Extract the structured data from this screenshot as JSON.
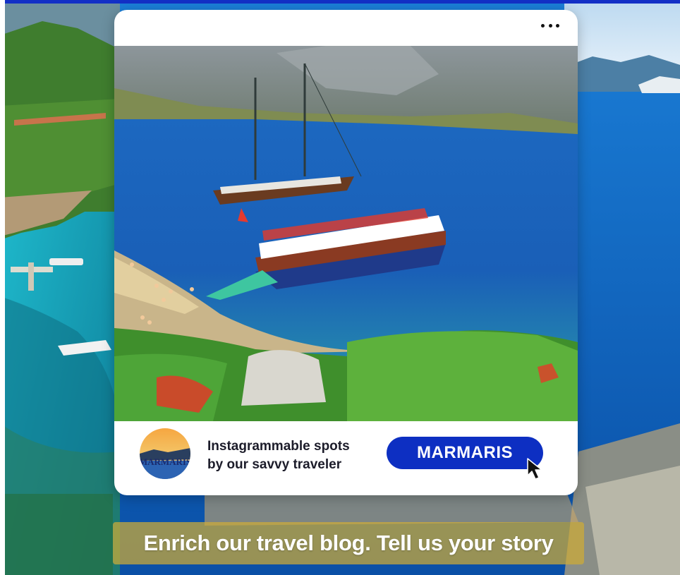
{
  "background": {
    "description_icon": "coastline-background-image"
  },
  "post": {
    "menu_icon": "more-horizontal-icon",
    "photo_icon": "marmaris-gulet-boats-photo",
    "avatar": {
      "icon": "marmaris-avatar-image",
      "text": "MARMARIS"
    },
    "tagline_line1": "Instagrammable spots",
    "tagline_line2": "by our savvy traveler",
    "cta_label": "MARMARIS",
    "cursor_icon": "mouse-pointer-icon"
  },
  "banner": {
    "text": "Enrich our travel blog. Tell us your story"
  },
  "colors": {
    "top_bar": "#1330c6",
    "cta": "#0d2fc2",
    "banner": "#cfac36",
    "card": "#ffffff"
  }
}
